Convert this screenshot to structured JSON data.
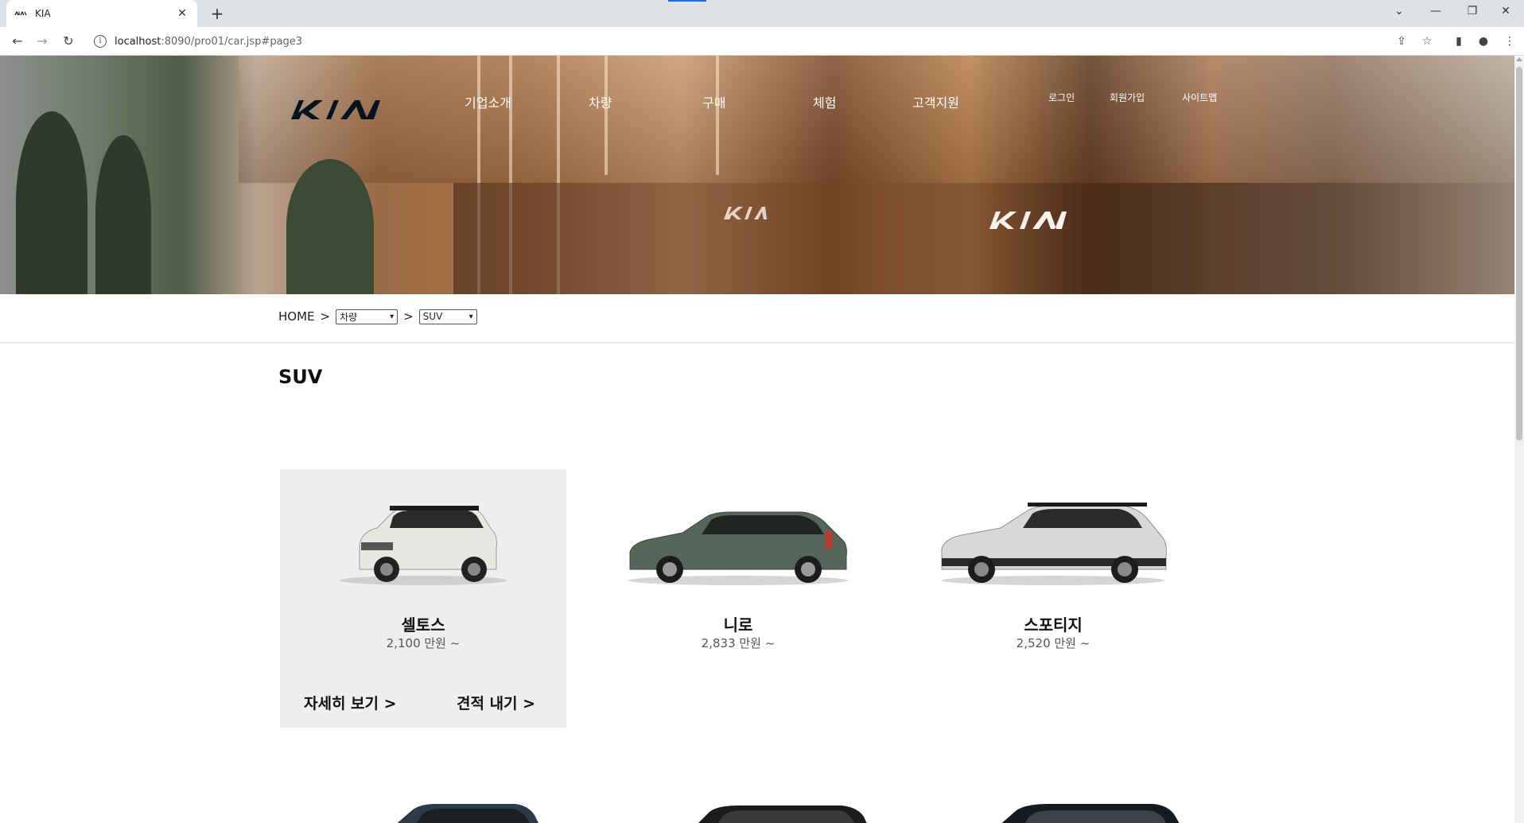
{
  "browser": {
    "tab_title": "KIA",
    "url_host": "localhost",
    "url_rest": ":8090/pro01/car.jsp#page3"
  },
  "header": {
    "nav": [
      "기업소개",
      "차량",
      "구매",
      "체험",
      "고객지원"
    ],
    "util": [
      "로그인",
      "회원가입",
      "사이트맵"
    ]
  },
  "breadcrumb": {
    "home": "HOME",
    "sep": ">",
    "select1": "차량",
    "select2": "SUV"
  },
  "section": {
    "title": "SUV"
  },
  "cards": [
    {
      "name": "셀토스",
      "price": "2,100 만원 ~",
      "detail": "자세히 보기 >",
      "quote": "견적 내기 >",
      "color": "#e9e7e2",
      "roof": "#1b1b1b"
    },
    {
      "name": "니로",
      "price": "2,833 만원 ~",
      "color": "#56665b",
      "roof": "#56665b"
    },
    {
      "name": "스포티지",
      "price": "2,520 만원 ~",
      "color": "#d7d8d8",
      "roof": "#1b1b1b"
    }
  ],
  "colors": {
    "brand": "#05141f",
    "active_card": "#efefef",
    "link": "#1a73e8"
  }
}
